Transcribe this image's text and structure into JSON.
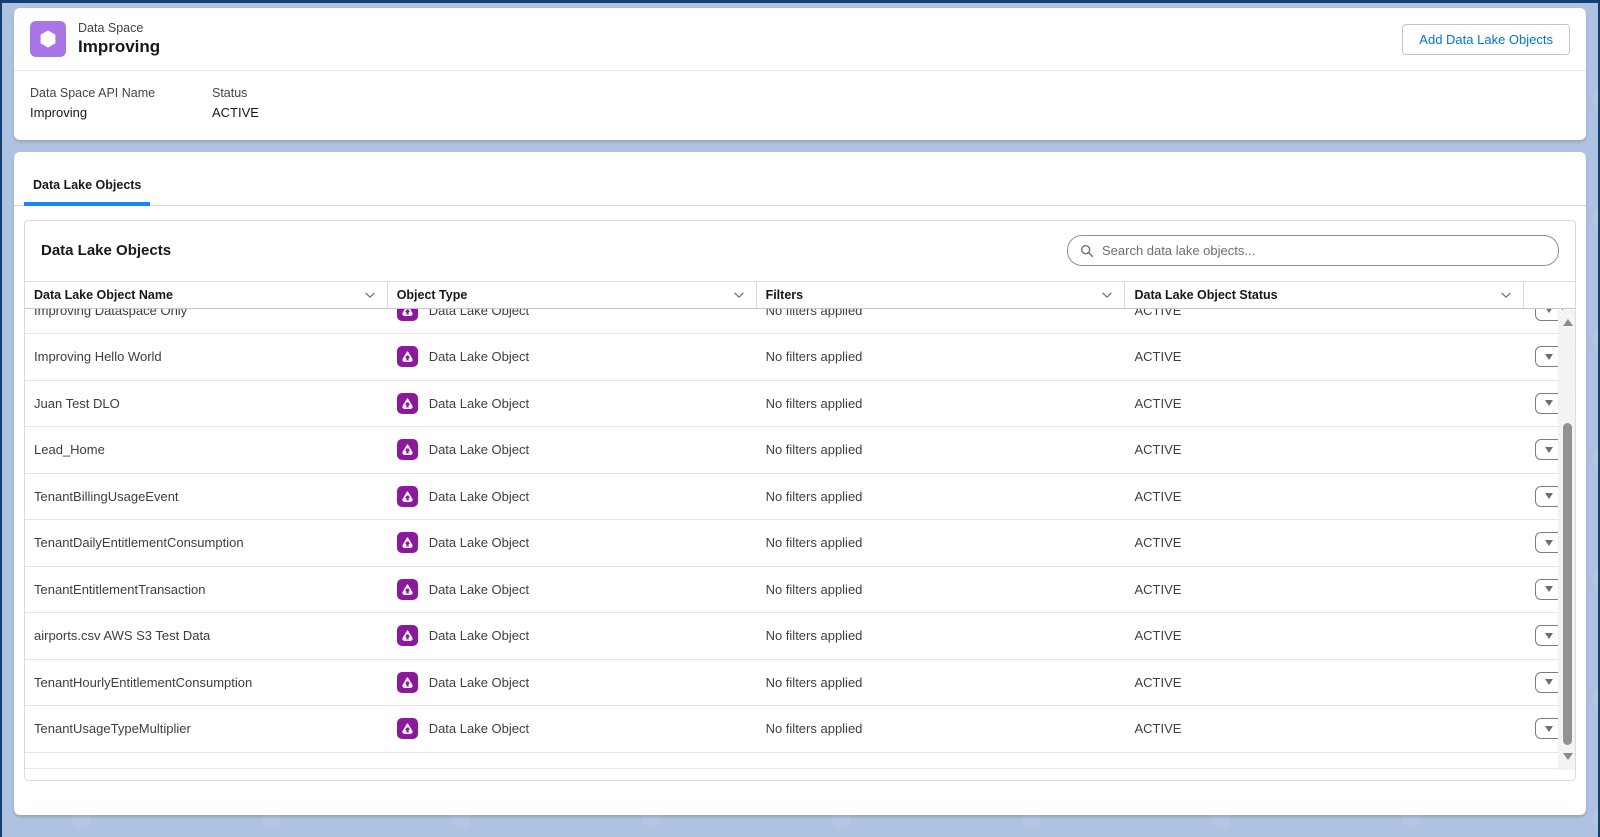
{
  "page": {
    "entity_label": "Data Space",
    "title": "Improving"
  },
  "header": {
    "add_button_label": "Add Data Lake Objects",
    "fields": [
      {
        "label": "Data Space API Name",
        "value": "Improving"
      },
      {
        "label": "Status",
        "value": "ACTIVE"
      }
    ]
  },
  "tabs": [
    {
      "label": "Data Lake Objects",
      "active": true
    }
  ],
  "panel": {
    "title": "Data Lake Objects",
    "search_placeholder": "Search data lake objects..."
  },
  "table": {
    "columns": [
      "Data Lake Object Name",
      "Object Type",
      "Filters",
      "Data Lake Object Status"
    ],
    "rows": [
      {
        "name": "Improving Dataspace Only",
        "type": "Data Lake Object",
        "filters": "No filters applied",
        "status": "ACTIVE"
      },
      {
        "name": "Improving Hello World",
        "type": "Data Lake Object",
        "filters": "No filters applied",
        "status": "ACTIVE"
      },
      {
        "name": "Juan Test DLO",
        "type": "Data Lake Object",
        "filters": "No filters applied",
        "status": "ACTIVE"
      },
      {
        "name": "Lead_Home",
        "type": "Data Lake Object",
        "filters": "No filters applied",
        "status": "ACTIVE"
      },
      {
        "name": "TenantBillingUsageEvent",
        "type": "Data Lake Object",
        "filters": "No filters applied",
        "status": "ACTIVE"
      },
      {
        "name": "TenantDailyEntitlementConsumption",
        "type": "Data Lake Object",
        "filters": "No filters applied",
        "status": "ACTIVE"
      },
      {
        "name": "TenantEntitlementTransaction",
        "type": "Data Lake Object",
        "filters": "No filters applied",
        "status": "ACTIVE"
      },
      {
        "name": "airports.csv AWS S3 Test Data",
        "type": "Data Lake Object",
        "filters": "No filters applied",
        "status": "ACTIVE"
      },
      {
        "name": "TenantHourlyEntitlementConsumption",
        "type": "Data Lake Object",
        "filters": "No filters applied",
        "status": "ACTIVE"
      },
      {
        "name": "TenantUsageTypeMultiplier",
        "type": "Data Lake Object",
        "filters": "No filters applied",
        "status": "ACTIVE"
      }
    ]
  },
  "icons": {
    "data_space": "hexagon",
    "data_lake_object": "triangle-nodes",
    "search": "magnifier",
    "column_sort": "chevron-down",
    "row_actions": "caret-down",
    "scroll_up": "caret-up",
    "scroll_down": "caret-down"
  },
  "colors": {
    "brand_blue": "#0176d3",
    "tab_underline": "#1589ee",
    "data_space_icon_bg": "#A874E6",
    "data_lake_object_icon_bg": "#8A1A9B",
    "page_background": "#AEC3E1",
    "frame_navy": "#16406F",
    "text_primary": "#181818",
    "text_secondary": "#444444",
    "border": "#DDDBDA"
  }
}
